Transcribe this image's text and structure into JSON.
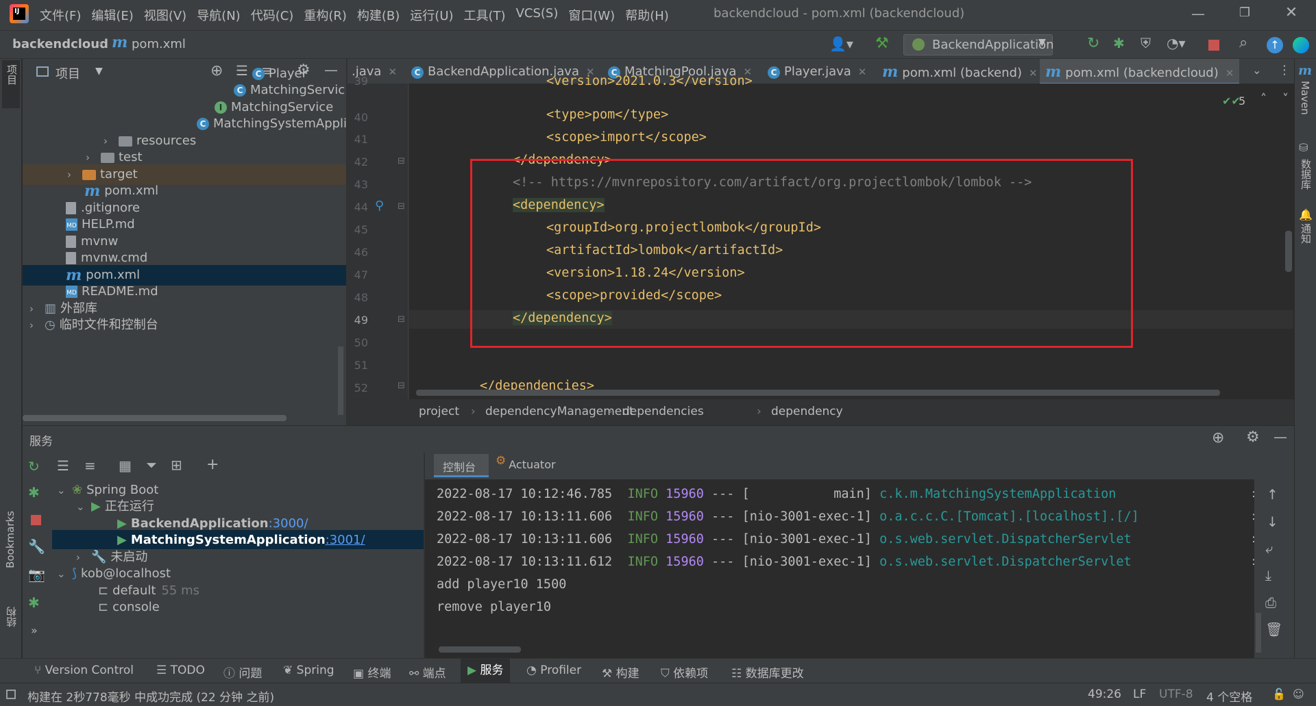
{
  "window": {
    "title": "backendcloud - pom.xml (backendcloud)",
    "menu": [
      "文件(F)",
      "编辑(E)",
      "视图(V)",
      "导航(N)",
      "代码(C)",
      "重构(R)",
      "构建(B)",
      "运行(U)",
      "工具(T)",
      "VCS(S)",
      "窗口(W)",
      "帮助(H)"
    ]
  },
  "nav": {
    "project": "backendcloud",
    "file": "pom.xml",
    "run_config": "BackendApplication"
  },
  "project_panel": {
    "title": "项目",
    "tree": [
      {
        "label": "Player",
        "icon": "class-icon"
      },
      {
        "label": "MatchingServic",
        "icon": "class-icon"
      },
      {
        "label": "MatchingService",
        "icon": "interface-icon"
      },
      {
        "label": "MatchingSystemAppli",
        "icon": "spring-class-icon"
      },
      {
        "label": "resources",
        "icon": "folder-icon"
      },
      {
        "label": "test",
        "icon": "folder-icon"
      },
      {
        "label": "target",
        "icon": "folder-icon"
      },
      {
        "label": "pom.xml",
        "icon": "maven-icon"
      },
      {
        "label": ".gitignore",
        "icon": "file-icon"
      },
      {
        "label": "HELP.md",
        "icon": "markdown-icon"
      },
      {
        "label": "mvnw",
        "icon": "file-icon"
      },
      {
        "label": "mvnw.cmd",
        "icon": "file-icon"
      },
      {
        "label": "pom.xml",
        "icon": "maven-icon"
      },
      {
        "label": "README.md",
        "icon": "markdown-icon"
      },
      {
        "label": "外部库",
        "icon": "library-icon"
      },
      {
        "label": "临时文件和控制台",
        "icon": "scratch-icon"
      }
    ]
  },
  "tabs": [
    {
      "label": ".java"
    },
    {
      "label": "BackendApplication.java"
    },
    {
      "label": "MatchingPool.java"
    },
    {
      "label": "Player.java"
    },
    {
      "label": "pom.xml (backend)"
    },
    {
      "label": "pom.xml (backendcloud)",
      "active": true
    }
  ],
  "editor": {
    "problems_count": "5",
    "lines": [
      {
        "n": "39",
        "text": "<version>2021.0.3</version>"
      },
      {
        "n": "40",
        "text": "<type>pom</type>"
      },
      {
        "n": "41",
        "text": "<scope>import</scope>"
      },
      {
        "n": "42",
        "text": "</dependency>"
      },
      {
        "n": "43",
        "text": "<!-- https://mvnrepository.com/artifact/org.projectlombok/lombok -->"
      },
      {
        "n": "44",
        "text": "<dependency>"
      },
      {
        "n": "45",
        "text": "<groupId>org.projectlombok</groupId>"
      },
      {
        "n": "46",
        "text": "<artifactId>lombok</artifactId>"
      },
      {
        "n": "47",
        "text": "<version>1.18.24</version>"
      },
      {
        "n": "48",
        "text": "<scope>provided</scope>"
      },
      {
        "n": "49",
        "text": "</dependency>"
      },
      {
        "n": "50",
        "text": ""
      },
      {
        "n": "51",
        "text": ""
      },
      {
        "n": "52",
        "text": "</dependencies>"
      }
    ],
    "breadcrumb": [
      "project",
      "dependencyManagement",
      "dependencies",
      "dependency"
    ]
  },
  "services": {
    "title": "服务",
    "tree": [
      {
        "label": "Spring Boot"
      },
      {
        "label": "正在运行"
      },
      {
        "label": "BackendApplication",
        "port": ":3000/"
      },
      {
        "label": "MatchingSystemApplication",
        "port": ":3001/"
      },
      {
        "label": "未启动"
      },
      {
        "label": "kob@localhost"
      },
      {
        "label": "default",
        "extra": "55 ms"
      },
      {
        "label": "console"
      }
    ],
    "console_tab": "控制台",
    "actuator_tab": "Actuator",
    "logs": [
      {
        "ts": "2022-08-17 10:12:46.785",
        "level": "INFO",
        "pid": "15960",
        "thread": "--- [           main]",
        "cls": "c.k.m.MatchingSystemApplication"
      },
      {
        "ts": "2022-08-17 10:13:11.606",
        "level": "INFO",
        "pid": "15960",
        "thread": "--- [nio-3001-exec-1]",
        "cls": "o.a.c.c.C.[Tomcat].[localhost].[/]"
      },
      {
        "ts": "2022-08-17 10:13:11.606",
        "level": "INFO",
        "pid": "15960",
        "thread": "--- [nio-3001-exec-1]",
        "cls": "o.s.web.servlet.DispatcherServlet"
      },
      {
        "ts": "2022-08-17 10:13:11.612",
        "level": "INFO",
        "pid": "15960",
        "thread": "--- [nio-3001-exec-1]",
        "cls": "o.s.web.servlet.DispatcherServlet"
      }
    ],
    "output": [
      "add player10 1500",
      "remove player10"
    ]
  },
  "toolwindows": [
    "Version Control",
    "TODO",
    "问题",
    "Spring",
    "终端",
    "端点",
    "服务",
    "Profiler",
    "构建",
    "依赖项",
    "数据库更改"
  ],
  "left_strip": [
    "项目",
    "Bookmarks",
    "结构"
  ],
  "right_strip": [
    "Maven",
    "数据库",
    "通知"
  ],
  "status": {
    "message": "构建在 2秒778毫秒 中成功完成 (22 分钟 之前)",
    "position": "49:26",
    "line_sep": "LF",
    "encoding": "UTF-8",
    "indent": "4 个空格"
  }
}
